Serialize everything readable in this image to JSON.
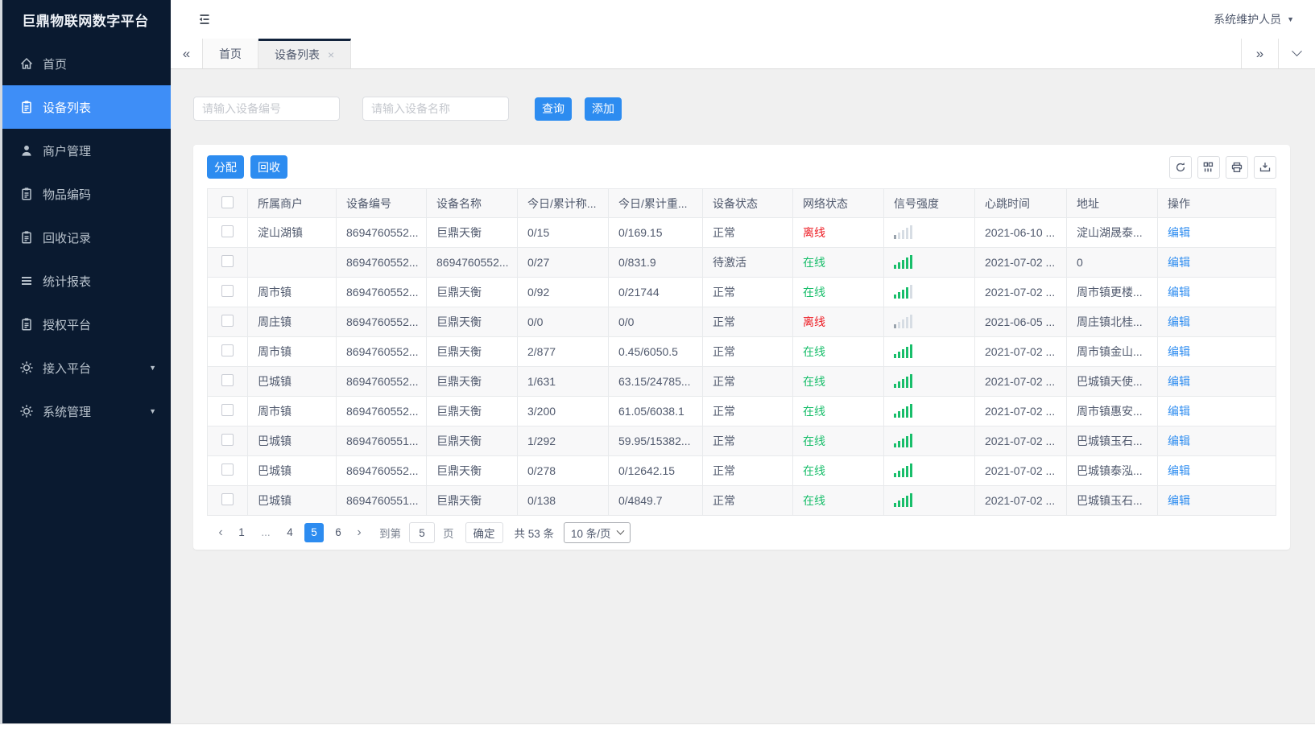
{
  "colors": {
    "accent": "#2d8cf0",
    "success": "#19be6b",
    "danger": "#ed1b23",
    "sidebar_bg": "#0a1a30",
    "sidebar_active": "#3e8ef7",
    "sidebar_text": "#b8c2cc"
  },
  "app": {
    "logo": "巨鼎物联网数字平台",
    "user_name": "系统维护人员"
  },
  "sidebar": {
    "items": [
      {
        "label": "首页",
        "icon": "home",
        "active": false,
        "arrow": false
      },
      {
        "label": "设备列表",
        "icon": "device-list",
        "active": true,
        "arrow": false
      },
      {
        "label": "商户管理",
        "icon": "merchant",
        "active": false,
        "arrow": false
      },
      {
        "label": "物品编码",
        "icon": "item-code",
        "active": false,
        "arrow": false
      },
      {
        "label": "回收记录",
        "icon": "recycle-record",
        "active": false,
        "arrow": false
      },
      {
        "label": "统计报表",
        "icon": "report",
        "active": false,
        "arrow": false
      },
      {
        "label": "授权平台",
        "icon": "authorize",
        "active": false,
        "arrow": false
      },
      {
        "label": "接入平台",
        "icon": "access-platform",
        "active": false,
        "arrow": true
      },
      {
        "label": "系统管理",
        "icon": "system-manage",
        "active": false,
        "arrow": true
      }
    ]
  },
  "tabs": {
    "collapse_left": "«",
    "scroll_right": "»",
    "items": [
      {
        "label": "首页",
        "active": false,
        "closable": false
      },
      {
        "label": "设备列表",
        "active": true,
        "closable": true
      }
    ],
    "close_glyph": "×"
  },
  "filters": {
    "device_no_placeholder": "请输入设备编号",
    "device_name_placeholder": "请输入设备名称",
    "query_label": "查询",
    "add_label": "添加"
  },
  "toolbar": {
    "assign_label": "分配",
    "recycle_label": "回收",
    "icons": [
      "refresh",
      "columns",
      "print",
      "export"
    ]
  },
  "table": {
    "columns": [
      "所属商户",
      "设备编号",
      "设备名称",
      "今日/累计称...",
      "今日/累计重...",
      "设备状态",
      "网络状态",
      "信号强度",
      "心跳时间",
      "地址",
      "操作"
    ],
    "rows": [
      {
        "merchant": "淀山湖镇",
        "device_no": "8694760552...",
        "device_name": "巨鼎天衡",
        "today_count": "0/15",
        "today_weight": "0/169.15",
        "device_status": "正常",
        "network_status": "离线",
        "network_state": "offline",
        "signal_level": 1,
        "signal_state": "offline",
        "heartbeat": "2021-06-10 ...",
        "address": "淀山湖晟泰...",
        "action": "编辑"
      },
      {
        "merchant": "",
        "device_no": "8694760552...",
        "device_name": "8694760552...",
        "today_count": "0/27",
        "today_weight": "0/831.9",
        "device_status": "待激活",
        "network_status": "在线",
        "network_state": "online",
        "signal_level": 5,
        "signal_state": "online",
        "heartbeat": "2021-07-02 ...",
        "address": "0",
        "action": "编辑"
      },
      {
        "merchant": "周市镇",
        "device_no": "8694760552...",
        "device_name": "巨鼎天衡",
        "today_count": "0/92",
        "today_weight": "0/21744",
        "device_status": "正常",
        "network_status": "在线",
        "network_state": "online",
        "signal_level": 4,
        "signal_state": "online",
        "heartbeat": "2021-07-02 ...",
        "address": "周市镇更楼...",
        "action": "编辑"
      },
      {
        "merchant": "周庄镇",
        "device_no": "8694760552...",
        "device_name": "巨鼎天衡",
        "today_count": "0/0",
        "today_weight": "0/0",
        "device_status": "正常",
        "network_status": "离线",
        "network_state": "offline",
        "signal_level": 1,
        "signal_state": "offline",
        "heartbeat": "2021-06-05 ...",
        "address": "周庄镇北桂...",
        "action": "编辑"
      },
      {
        "merchant": "周市镇",
        "device_no": "8694760552...",
        "device_name": "巨鼎天衡",
        "today_count": "2/877",
        "today_weight": "0.45/6050.5",
        "device_status": "正常",
        "network_status": "在线",
        "network_state": "online",
        "signal_level": 5,
        "signal_state": "online",
        "heartbeat": "2021-07-02 ...",
        "address": "周市镇金山...",
        "action": "编辑"
      },
      {
        "merchant": "巴城镇",
        "device_no": "8694760552...",
        "device_name": "巨鼎天衡",
        "today_count": "1/631",
        "today_weight": "63.15/24785...",
        "device_status": "正常",
        "network_status": "在线",
        "network_state": "online",
        "signal_level": 5,
        "signal_state": "online",
        "heartbeat": "2021-07-02 ...",
        "address": "巴城镇天使...",
        "action": "编辑"
      },
      {
        "merchant": "周市镇",
        "device_no": "8694760552...",
        "device_name": "巨鼎天衡",
        "today_count": "3/200",
        "today_weight": "61.05/6038.1",
        "device_status": "正常",
        "network_status": "在线",
        "network_state": "online",
        "signal_level": 5,
        "signal_state": "online",
        "heartbeat": "2021-07-02 ...",
        "address": "周市镇惠安...",
        "action": "编辑"
      },
      {
        "merchant": "巴城镇",
        "device_no": "8694760551...",
        "device_name": "巨鼎天衡",
        "today_count": "1/292",
        "today_weight": "59.95/15382...",
        "device_status": "正常",
        "network_status": "在线",
        "network_state": "online",
        "signal_level": 5,
        "signal_state": "online",
        "heartbeat": "2021-07-02 ...",
        "address": "巴城镇玉石...",
        "action": "编辑"
      },
      {
        "merchant": "巴城镇",
        "device_no": "8694760552...",
        "device_name": "巨鼎天衡",
        "today_count": "0/278",
        "today_weight": "0/12642.15",
        "device_status": "正常",
        "network_status": "在线",
        "network_state": "online",
        "signal_level": 5,
        "signal_state": "online",
        "heartbeat": "2021-07-02 ...",
        "address": "巴城镇泰泓...",
        "action": "编辑"
      },
      {
        "merchant": "巴城镇",
        "device_no": "8694760551...",
        "device_name": "巨鼎天衡",
        "today_count": "0/138",
        "today_weight": "0/4849.7",
        "device_status": "正常",
        "network_status": "在线",
        "network_state": "online",
        "signal_level": 5,
        "signal_state": "online",
        "heartbeat": "2021-07-02 ...",
        "address": "巴城镇玉石...",
        "action": "编辑"
      }
    ]
  },
  "pagination": {
    "prev": "‹",
    "next": "›",
    "pages": [
      {
        "label": "1",
        "active": false
      },
      {
        "label": "...",
        "active": false
      },
      {
        "label": "4",
        "active": false
      },
      {
        "label": "5",
        "active": true
      },
      {
        "label": "6",
        "active": false
      }
    ],
    "goto_label": "到第",
    "goto_value": "5",
    "page_unit": "页",
    "confirm_label": "确定",
    "total_text": "共 53 条",
    "page_size": "10 条/页"
  }
}
